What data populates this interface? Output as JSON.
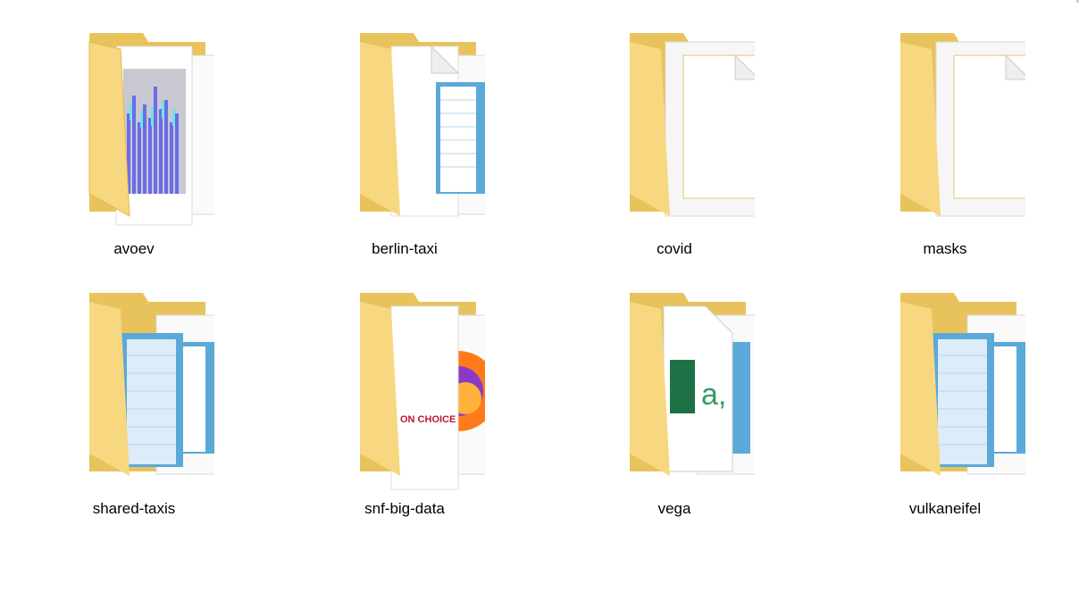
{
  "folders": [
    {
      "name": "avoev",
      "preview": "chart",
      "preview_text": "",
      "icon": "folder-icon"
    },
    {
      "name": "berlin-taxi",
      "preview": "notepad",
      "preview_text": "",
      "icon": "folder-icon"
    },
    {
      "name": "covid",
      "preview": "blank",
      "preview_text": "",
      "icon": "folder-icon"
    },
    {
      "name": "masks",
      "preview": "blank",
      "preview_text": "",
      "icon": "folder-icon"
    },
    {
      "name": "shared-taxis",
      "preview": "notepad",
      "preview_text": "",
      "icon": "folder-icon"
    },
    {
      "name": "snf-big-data",
      "preview": "firefox",
      "preview_text": "ON CHOICE",
      "icon": "folder-icon"
    },
    {
      "name": "vega",
      "preview": "excel",
      "preview_text": "a,",
      "icon": "folder-icon"
    },
    {
      "name": "vulkaneifel",
      "preview": "notepad",
      "preview_text": "",
      "icon": "folder-icon"
    }
  ],
  "colors": {
    "folder_back": "#e8c35c",
    "folder_front": "#f7d77f",
    "folder_front_light": "#fbe7a6",
    "paper": "#ffffff",
    "notepad_blue": "#5aa9d8",
    "excel_green": "#1e7145",
    "firefox_orange": "#ff7a1a",
    "chart_blue": "#6a6de6",
    "chart_cyan": "#6fe3e3"
  }
}
